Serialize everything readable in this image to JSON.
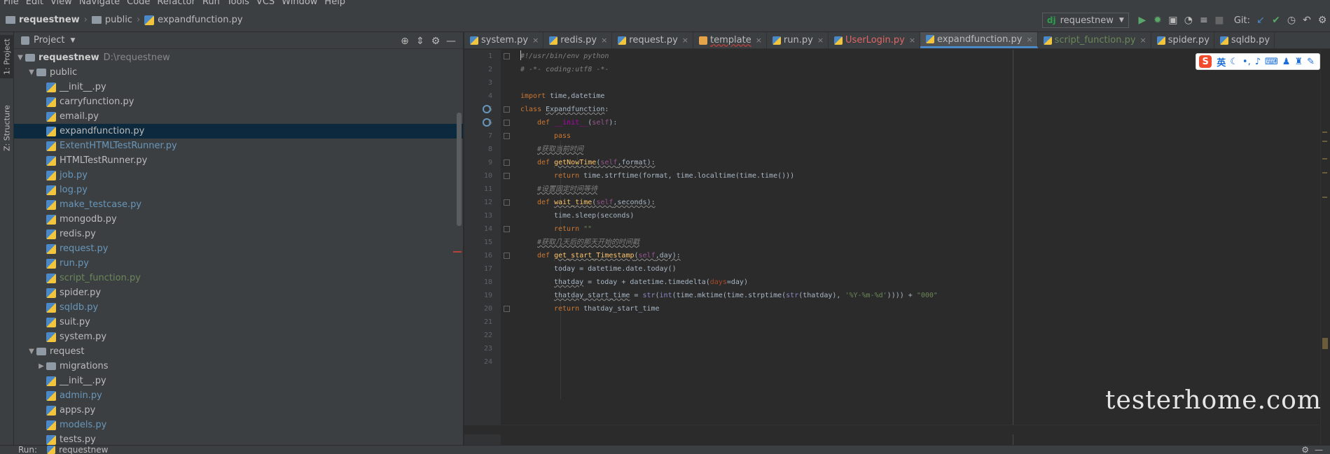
{
  "menu": [
    "File",
    "Edit",
    "View",
    "Navigate",
    "Code",
    "Refactor",
    "Run",
    "Tools",
    "VCS",
    "Window",
    "Help"
  ],
  "breadcrumb": {
    "project": "requestnew",
    "folder": "public",
    "file": "expandfunction.py"
  },
  "toolbar": {
    "run_config": "requestnew",
    "run_config_badge": "dj",
    "git_label": "Git:"
  },
  "left_strip": {
    "project_tab": "1: Project",
    "structure_tab": "Z: Structure"
  },
  "project_panel": {
    "title": "Project",
    "root": {
      "name": "requestnew",
      "path": "D:\\requestnew"
    },
    "items": [
      {
        "name": "public",
        "type": "dir",
        "level": 1,
        "expanded": true
      },
      {
        "name": "__init__.py",
        "type": "py",
        "level": 2
      },
      {
        "name": "carryfunction.py",
        "type": "py",
        "level": 2
      },
      {
        "name": "email.py",
        "type": "py",
        "level": 2
      },
      {
        "name": "expandfunction.py",
        "type": "py",
        "level": 2,
        "selected": true
      },
      {
        "name": "ExtentHTMLTestRunner.py",
        "type": "py",
        "level": 2,
        "color": "blue"
      },
      {
        "name": "HTMLTestRunner.py",
        "type": "py",
        "level": 2
      },
      {
        "name": "job.py",
        "type": "py",
        "level": 2,
        "color": "blue"
      },
      {
        "name": "log.py",
        "type": "py",
        "level": 2,
        "color": "blue"
      },
      {
        "name": "make_testcase.py",
        "type": "py",
        "level": 2,
        "color": "blue"
      },
      {
        "name": "mongodb.py",
        "type": "py",
        "level": 2
      },
      {
        "name": "redis.py",
        "type": "py",
        "level": 2
      },
      {
        "name": "request.py",
        "type": "py",
        "level": 2,
        "color": "blue"
      },
      {
        "name": "run.py",
        "type": "py",
        "level": 2,
        "color": "blue"
      },
      {
        "name": "script_function.py",
        "type": "py",
        "level": 2,
        "color": "green"
      },
      {
        "name": "spider.py",
        "type": "py",
        "level": 2
      },
      {
        "name": "sqldb.py",
        "type": "py",
        "level": 2,
        "color": "blue"
      },
      {
        "name": "suit.py",
        "type": "py",
        "level": 2
      },
      {
        "name": "system.py",
        "type": "py",
        "level": 2
      },
      {
        "name": "request",
        "type": "dir",
        "level": 1,
        "expanded": true
      },
      {
        "name": "migrations",
        "type": "dir",
        "level": 2,
        "expanded": false
      },
      {
        "name": "__init__.py",
        "type": "py",
        "level": 2
      },
      {
        "name": "admin.py",
        "type": "py",
        "level": 2,
        "color": "blue"
      },
      {
        "name": "apps.py",
        "type": "py",
        "level": 2
      },
      {
        "name": "models.py",
        "type": "py",
        "level": 2,
        "color": "blue"
      },
      {
        "name": "tests.py",
        "type": "py",
        "level": 2
      }
    ]
  },
  "tabs": [
    {
      "label": "system.py",
      "kind": "py"
    },
    {
      "label": "redis.py",
      "kind": "py"
    },
    {
      "label": "request.py",
      "kind": "py"
    },
    {
      "label": "template",
      "kind": "html",
      "style": "wavy"
    },
    {
      "label": "run.py",
      "kind": "py"
    },
    {
      "label": "UserLogin.py",
      "kind": "py",
      "style": "red"
    },
    {
      "label": "expandfunction.py",
      "kind": "py",
      "active": true
    },
    {
      "label": "script_function.py",
      "kind": "py",
      "style": "green"
    },
    {
      "label": "spider.py",
      "kind": "py"
    },
    {
      "label": "sqldb.py",
      "kind": "py"
    }
  ],
  "ime": {
    "logo": "S",
    "lang": "英"
  },
  "line_numbers": [
    "1",
    "2",
    "3",
    "4",
    "5",
    "6",
    "7",
    "8",
    "9",
    "10",
    "11",
    "12",
    "13",
    "14",
    "15",
    "16",
    "17",
    "18",
    "19",
    "20",
    "21",
    "22",
    "23",
    "24"
  ],
  "code": {
    "l1": "#!/usr/bin/env python",
    "l2": "# -*- coding:utf8 -*-",
    "l4a": "import",
    "l4b": " time,datetime",
    "l5a": "class ",
    "l5b": "Expandfunction",
    "l5c": ":",
    "l6a": "def ",
    "l6b": "__init__",
    "l6c": "(",
    "l6d": "self",
    "l6e": "):",
    "l7": "pass",
    "l8": "#获取当前时间",
    "l9a": "def ",
    "l9b": "getNowTime",
    "l9c": "(",
    "l9d": "self",
    "l9e": ",format):",
    "l10a": "return ",
    "l10b": "time.strftime(format, time.localtime(time.time()))",
    "l11": "#设置固定时间等待",
    "l12a": "def ",
    "l12b": "wait_time",
    "l12c": "(",
    "l12d": "self",
    "l12e": ",seconds):",
    "l13": "time.sleep(seconds)",
    "l14a": "return ",
    "l14b": "\"\"",
    "l15": "#获取几天后的那天开始的时间戳",
    "l16a": "def ",
    "l16b": "get_start_Timestamp",
    "l16c": "(",
    "l16d": "self",
    "l16e": ",day):",
    "l17": "today = datetime.date.today()",
    "l18a": "thatday",
    "l18b": " = today + datetime.timedelta(",
    "l18c": "days",
    "l18d": "=day)",
    "l19a": "thatday_start_time",
    "l19b": " = ",
    "l19c": "str",
    "l19d": "(",
    "l19e": "int",
    "l19f": "(time.mktime(time.strptime(",
    "l19g": "str",
    "l19h": "(thatday), ",
    "l19i": "'%Y-%m-%d'",
    "l19j": ")))) + ",
    "l19k": "\"000\"",
    "l20a": "return ",
    "l20b": "thatday_start_time"
  },
  "watermark": "testerhome.com",
  "run_panel": {
    "label": "Run:",
    "tab": "requestnew"
  }
}
